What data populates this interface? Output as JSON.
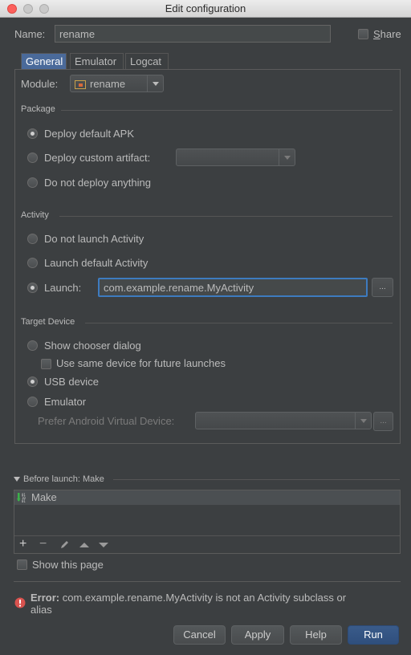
{
  "window": {
    "title": "Edit configuration"
  },
  "name": {
    "label": "Name:",
    "value": "rename",
    "share_label": "Share"
  },
  "tabs": [
    {
      "label": "General"
    },
    {
      "label": "Emulator"
    },
    {
      "label": "Logcat"
    }
  ],
  "module": {
    "label": "Module:",
    "value": "rename"
  },
  "package": {
    "title": "Package",
    "deploy_default": "Deploy default APK",
    "deploy_custom": "Deploy custom artifact:",
    "no_deploy": "Do not deploy anything"
  },
  "activity": {
    "title": "Activity",
    "no_launch": "Do not launch Activity",
    "launch_default": "Launch default Activity",
    "launch_label": "Launch:",
    "launch_value": "com.example.rename.MyActivity",
    "browse_label": "..."
  },
  "target": {
    "title": "Target Device",
    "chooser": "Show chooser dialog",
    "same_device": "Use same device for future launches",
    "usb": "USB device",
    "emulator": "Emulator",
    "prefer_avd": "Prefer Android Virtual Device:",
    "browse_label": "..."
  },
  "before_launch": {
    "title": "Before launch: Make",
    "items": [
      {
        "label": "Make",
        "icon": "make-icon"
      }
    ],
    "toolbar": [
      "+",
      "−",
      "edit",
      "up",
      "down"
    ]
  },
  "show_page": "Show this page",
  "error": {
    "prefix": "Error:",
    "message": "com.example.rename.MyActivity is not an Activity subclass or",
    "message2": "alias"
  },
  "buttons": {
    "cancel": "Cancel",
    "apply": "Apply",
    "help": "Help",
    "run": "Run"
  },
  "colors": {
    "accent": "#4a6a9a",
    "default_button": "#2f4f7d",
    "error": "#d9534f",
    "focus": "#3d7bbf"
  }
}
